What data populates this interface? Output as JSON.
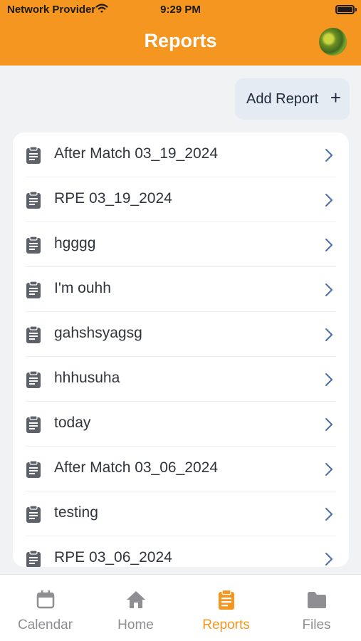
{
  "status_bar": {
    "carrier": "Network Provider",
    "time": "9:29 PM"
  },
  "header": {
    "title": "Reports",
    "accent_color": "#f4961f"
  },
  "add_report": {
    "label": "Add Report",
    "plus": "+"
  },
  "reports": [
    {
      "label": "After Match 03_19_2024"
    },
    {
      "label": "RPE 03_19_2024"
    },
    {
      "label": "hgggg"
    },
    {
      "label": "I'm ouhh"
    },
    {
      "label": "gahshsyagsg"
    },
    {
      "label": "hhhusuha"
    },
    {
      "label": "today"
    },
    {
      "label": "After Match 03_06_2024"
    },
    {
      "label": "testing"
    },
    {
      "label": "RPE 03_06_2024"
    }
  ],
  "icons": {
    "report_item": "clipboard-icon",
    "row_chevron": "chevron-right-icon",
    "add": "plus-icon"
  },
  "tabbar": {
    "active_tab": "Reports",
    "tabs": [
      {
        "label": "Calendar",
        "icon": "calendar-icon"
      },
      {
        "label": "Home",
        "icon": "home-icon"
      },
      {
        "label": "Reports",
        "icon": "clipboard-icon"
      },
      {
        "label": "Files",
        "icon": "folder-icon"
      }
    ]
  }
}
